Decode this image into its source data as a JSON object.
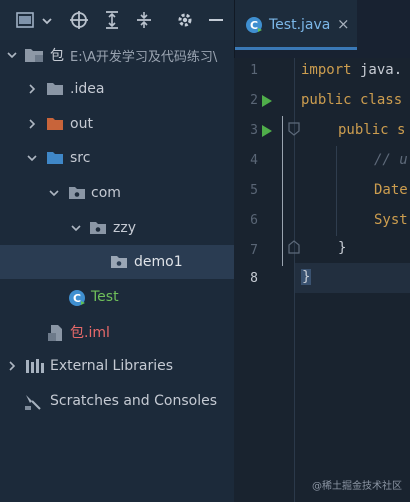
{
  "toolbar": {
    "icons": [
      "window-icon",
      "dropdown-arrow-icon",
      "crosshair-icon",
      "expand-all-icon",
      "collapse-all-icon",
      "gear-icon",
      "minimize-icon"
    ]
  },
  "tree": {
    "root_name": "包",
    "root_path": "E:\\A开发学习及代码练习\\",
    "idea": ".idea",
    "out": "out",
    "src": "src",
    "com": "com",
    "zzy": "zzy",
    "demo1": "demo1",
    "test": "Test",
    "iml": "包.iml",
    "ext_libs": "External Libraries",
    "scratches": "Scratches and Consoles"
  },
  "editor": {
    "tab_label": "Test.java",
    "tab_close": "×",
    "line_numbers": [
      "1",
      "2",
      "3",
      "4",
      "5",
      "6",
      "7",
      "8"
    ],
    "line1_kw": "import",
    "line1_rest": " java.",
    "line2_kw": "public class",
    "line3_kw": "public s",
    "line4_comment": "// u",
    "line5_text": "Date",
    "line6_text": "Syst",
    "line7_text": "}",
    "line8_text": "}"
  },
  "watermark": "@稀土掘金技术社区",
  "colors": {
    "background": "#1b2636",
    "keyword": "#cc9d4f",
    "run_arrow": "#4fae4a",
    "selection": "#2a3c52"
  }
}
